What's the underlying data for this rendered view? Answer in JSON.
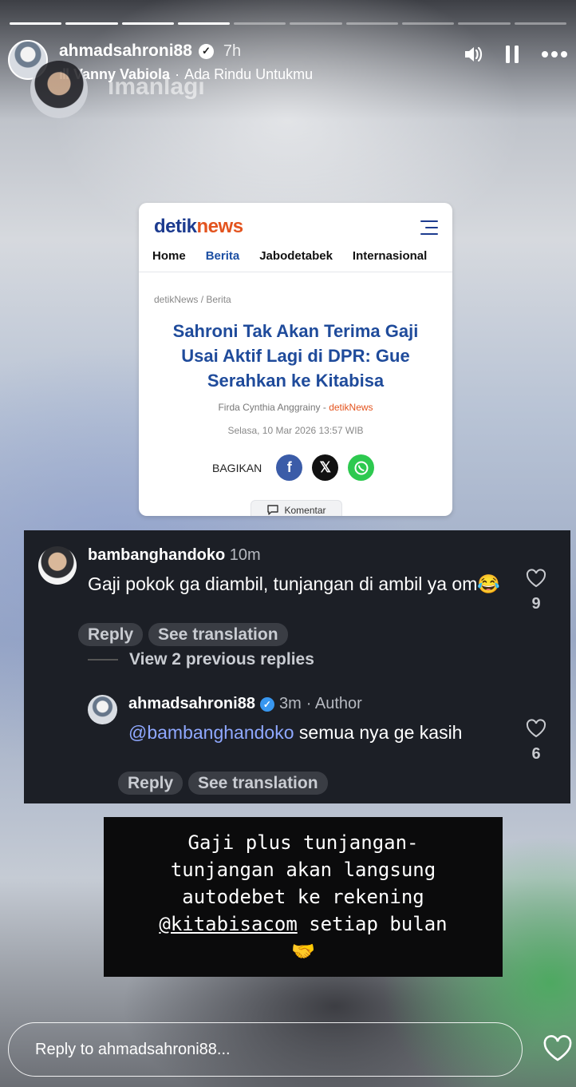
{
  "story": {
    "progress_total": 10,
    "progress_done": 4,
    "username": "ahmadsahroni88",
    "time": "7h",
    "music_artist": "Vanny Vabiola",
    "music_title": "Ada Rindu Untukmu",
    "music_separator": "·",
    "background_text": "imanlagi"
  },
  "article": {
    "logo_part1": "detik",
    "logo_part2": "news",
    "nav": [
      "Home",
      "Berita",
      "Jabodetabek",
      "Internasional"
    ],
    "nav_active": "Berita",
    "breadcrumb": "detikNews / Berita",
    "headline": "Sahroni Tak Akan Terima Gaji Usai Aktif Lagi di DPR: Gue Serahkan ke Kitabisa",
    "author": "Firda Cynthia Anggrainy - ",
    "source": "detikNews",
    "date": "Selasa, 10 Mar 2026 13:57 WIB",
    "share_label": "BAGIKAN",
    "komentar_label": "Komentar"
  },
  "comment": {
    "username": "bambanghandoko",
    "time": "10m",
    "text": "Gaji pokok ga diambil, tunjangan di ambil ya om😂",
    "likes": "9",
    "reply_label": "Reply",
    "translate_label": "See translation",
    "view_previous": "View 2 previous replies"
  },
  "reply": {
    "username": "ahmadsahroni88",
    "time": "3m",
    "author_tag": "· Author",
    "mention": "@bambanghandoko",
    "text": " semua nya ge kasih",
    "likes": "6",
    "reply_label": "Reply",
    "translate_label": "See translation"
  },
  "caption": {
    "line1": "Gaji plus tunjangan-",
    "line2": "tunjangan akan langsung",
    "line3": "autodebet ke rekening",
    "mention": "@kitabisacom",
    "line4_rest": " setiap bulan",
    "emoji": "🤝"
  },
  "reply_bar": {
    "placeholder": "Reply to ahmadsahroni88..."
  },
  "colors": {
    "detik_blue": "#1c3b8f",
    "detik_orange": "#e3541f",
    "headline": "#1f4b9b",
    "comment_bg": "#1c1f26",
    "mention": "#8fa8ff",
    "verified_blue": "#3897f0"
  },
  "icons": [
    "verified-badge-icon",
    "volume-icon",
    "pause-icon",
    "more-icon",
    "hamburger-menu-icon",
    "facebook-icon",
    "x-icon",
    "whatsapp-icon",
    "comment-icon",
    "heart-icon"
  ]
}
